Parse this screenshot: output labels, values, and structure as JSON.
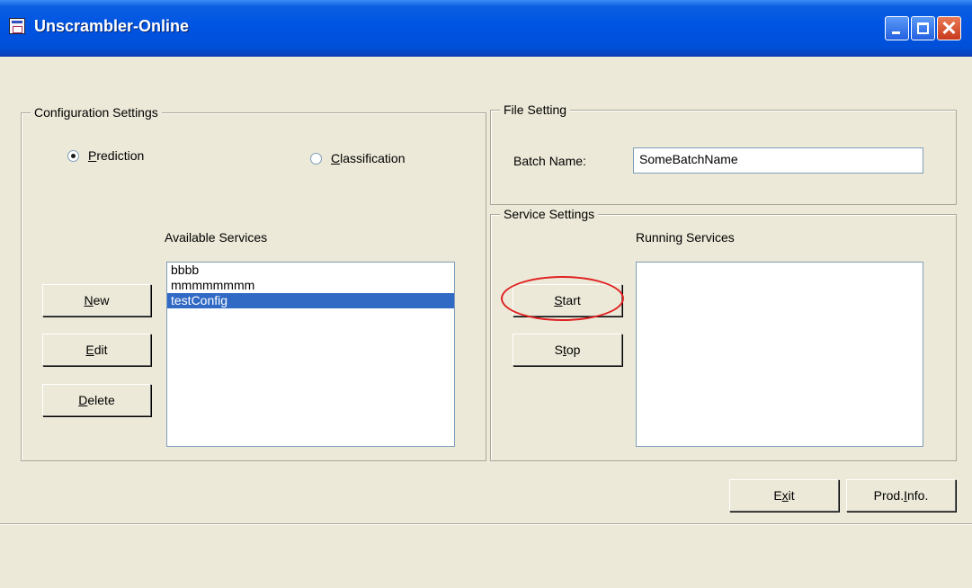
{
  "window": {
    "title": "Unscrambler-Online"
  },
  "config": {
    "legend": "Configuration Settings",
    "radio_prediction": {
      "pre": "",
      "key": "P",
      "post": "rediction"
    },
    "radio_classification": {
      "pre": "",
      "key": "C",
      "post": "lassification"
    },
    "available_label": "Available Services",
    "services": [
      "bbbb",
      "mmmmmmmm",
      "testConfig"
    ],
    "selected_index": 2,
    "buttons": {
      "new": {
        "pre": "",
        "key": "N",
        "post": "ew"
      },
      "edit": {
        "pre": "",
        "key": "E",
        "post": "dit"
      },
      "delete": {
        "pre": "",
        "key": "D",
        "post": "elete"
      }
    }
  },
  "file": {
    "legend": "File Setting",
    "batch_label": "Batch Name:",
    "batch_value": "SomeBatchName"
  },
  "service": {
    "legend": "Service Settings",
    "running_label": "Running Services",
    "running": [],
    "buttons": {
      "start": {
        "pre": "",
        "key": "S",
        "post": "tart"
      },
      "stop": {
        "pre": "S",
        "key": "t",
        "post": "op"
      }
    }
  },
  "footer": {
    "exit": {
      "pre": "E",
      "key": "x",
      "post": "it"
    },
    "prodinfo": {
      "pre": "Prod.",
      "key": "I",
      "post": "nfo."
    }
  },
  "colors": {
    "selection": "#316ac5",
    "highlight": "#e02020"
  },
  "icons": {
    "app": "app-window-icon",
    "min": "minimize-icon",
    "max": "maximize-icon",
    "close": "close-icon"
  }
}
